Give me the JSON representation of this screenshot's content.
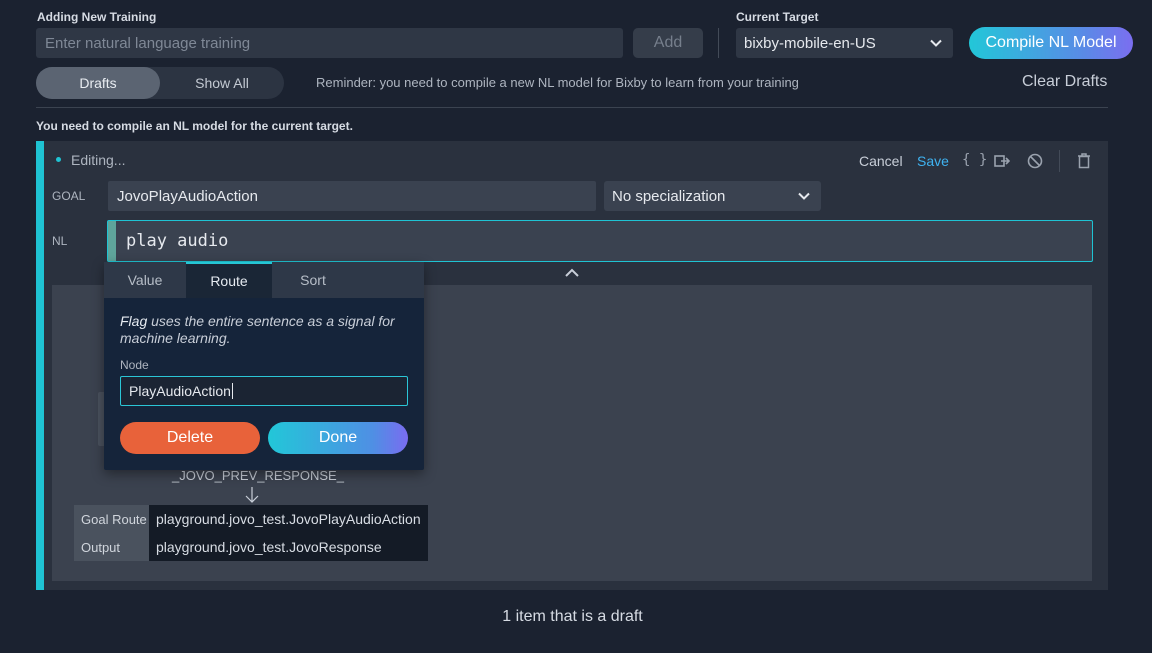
{
  "header": {
    "adding_label": "Adding New Training",
    "nl_placeholder": "Enter natural language training",
    "add_label": "Add",
    "target_label": "Current Target",
    "target_value": "bixby-mobile-en-US",
    "compile_label": "Compile NL Model"
  },
  "filter": {
    "drafts_label": "Drafts",
    "show_all_label": "Show All",
    "reminder": "Reminder: you need to compile a new NL model for Bixby to learn from your training",
    "clear_drafts_label": "Clear Drafts"
  },
  "warning": "You need to compile an NL model for the current target.",
  "editor": {
    "status": "Editing...",
    "cancel_label": "Cancel",
    "save_label": "Save",
    "json_label": "{ }",
    "goal_label": "GOAL",
    "goal_value": "JovoPlayAudioAction",
    "specialization_value": "No specialization",
    "nl_label": "NL",
    "nl_value": "play audio"
  },
  "popover": {
    "tabs": [
      {
        "label": "Value"
      },
      {
        "label": "Route"
      },
      {
        "label": "Sort"
      }
    ],
    "active_tab": "Route",
    "desc_em": "Flag",
    "desc_rest": " uses the entire sentence as a signal for machine learning.",
    "node_label": "Node",
    "node_value": "PlayAudioAction",
    "delete_label": "Delete",
    "done_label": "Done"
  },
  "graph": {
    "prev_response": "_JOVO_PREV_RESPONSE_",
    "rows": [
      {
        "key": "Goal Route",
        "value": "playground.jovo_test.JovoPlayAudioAction"
      },
      {
        "key": "Output",
        "value": "playground.jovo_test.JovoResponse"
      }
    ]
  },
  "footer": {
    "count_text": "1 item that is a draft"
  },
  "colors": {
    "accent_cyan": "#1fc3d3",
    "delete_orange": "#e8623a",
    "save_blue": "#3fb2f0"
  }
}
